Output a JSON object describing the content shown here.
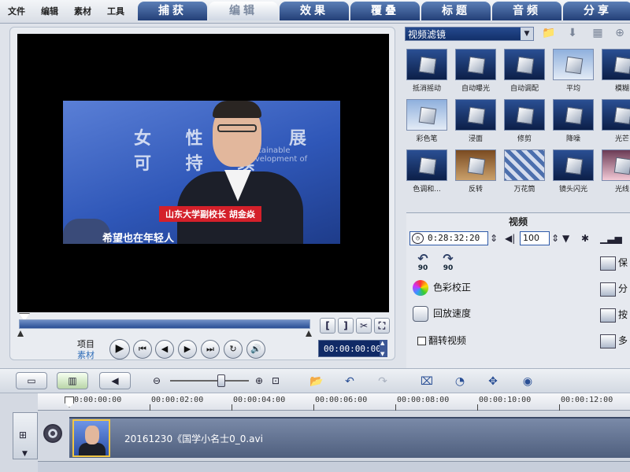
{
  "menu": [
    "文件",
    "编辑",
    "素材",
    "工具"
  ],
  "tabs": [
    {
      "label": "捕获",
      "active": false
    },
    {
      "label": "编辑",
      "active": true
    },
    {
      "label": "效果",
      "active": false
    },
    {
      "label": "覆叠",
      "active": false
    },
    {
      "label": "标题",
      "active": false
    },
    {
      "label": "音频",
      "active": false
    },
    {
      "label": "分享",
      "active": false
    }
  ],
  "preview": {
    "bg_text": "女 性 发 展 可 持 续",
    "bg_subtext": "Sustainable Development of",
    "caption_red": "山东大学副校长 胡金焱",
    "caption_sub": "希望也在年轻人"
  },
  "player": {
    "mode_project": "项目",
    "mode_clip": "素材",
    "timecode": "00:00:00:00",
    "bracket_in": "[",
    "bracket_out": "]",
    "scissors_icon": "scissors-icon",
    "expand_icon": "expand-icon"
  },
  "filters": {
    "dropdown": "视频滤镜",
    "items": [
      {
        "label": "抵消摇动",
        "style": "dark"
      },
      {
        "label": "自动曝光",
        "style": "dark"
      },
      {
        "label": "自动调配",
        "style": "dark"
      },
      {
        "label": "平均",
        "style": "light"
      },
      {
        "label": "模糊",
        "style": "dark"
      },
      {
        "label": "彩色笔",
        "style": "light"
      },
      {
        "label": "浸面",
        "style": "dark"
      },
      {
        "label": "修剪",
        "style": "dark"
      },
      {
        "label": "降噪",
        "style": "dark"
      },
      {
        "label": "光芒",
        "style": "dark"
      },
      {
        "label": "色调和...",
        "style": "dark"
      },
      {
        "label": "反转",
        "style": "warm"
      },
      {
        "label": "万花筒",
        "style": "pattern"
      },
      {
        "label": "镜头闪光",
        "style": "dark"
      },
      {
        "label": "光线",
        "style": "pink"
      }
    ]
  },
  "video_panel": {
    "title": "视频",
    "duration": "0:28:32:20",
    "volume": "100",
    "rotate_left": "90",
    "rotate_right": "90",
    "color_correction": "色彩校正",
    "playback_speed": "回放速度",
    "reverse_video": "翻转视频",
    "right_options": [
      "保",
      "分",
      "按",
      "多"
    ]
  },
  "timeline": {
    "ticks": [
      "00:00:00:00",
      "00:00:02:00",
      "00:00:04:00",
      "00:00:06:00",
      "00:00:08:00",
      "00:00:10:00",
      "00:00:12:00"
    ],
    "clip_name": "20161230《国学小名士0_0.avi"
  }
}
